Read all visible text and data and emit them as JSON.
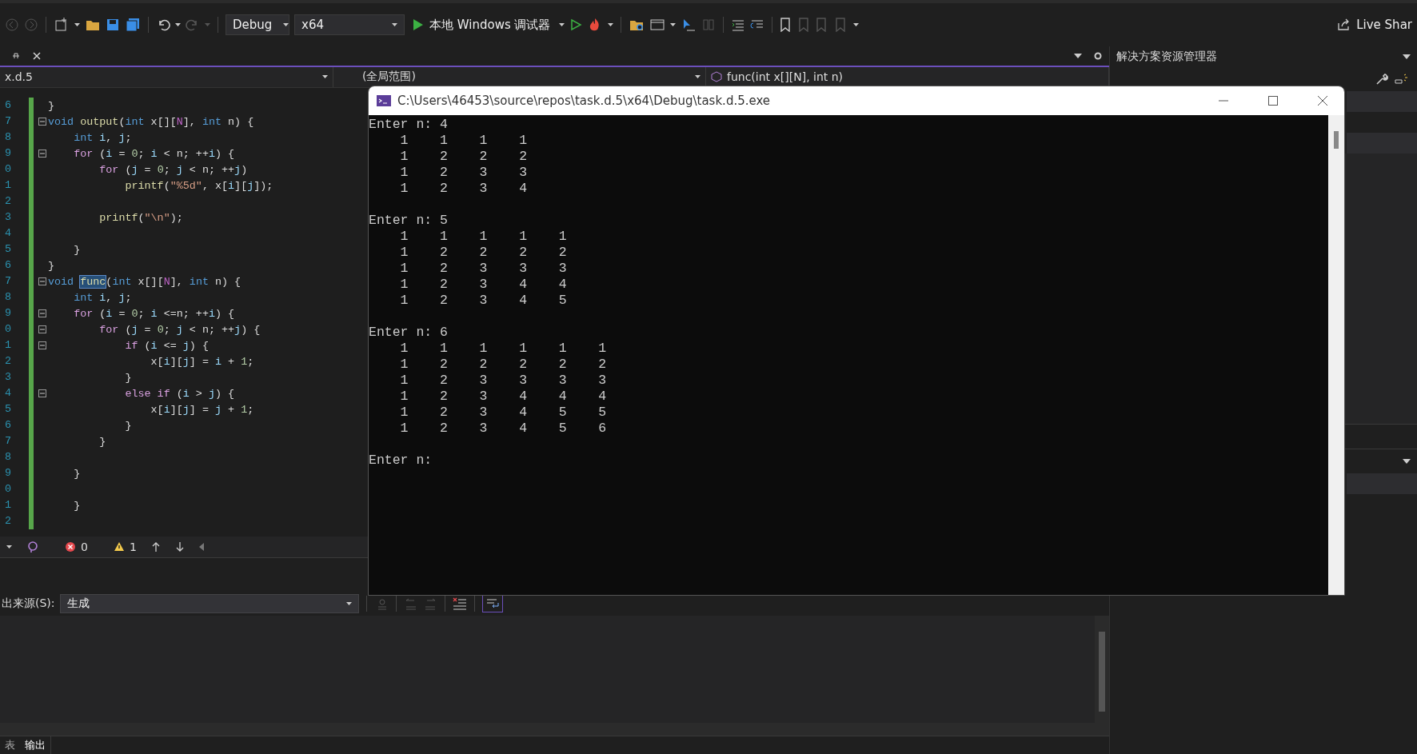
{
  "toolbar": {
    "configuration": "Debug",
    "platform": "x64",
    "run_label": "本地 Windows 调试器",
    "live_share": "Live Shar"
  },
  "navbar": {
    "project": "x.d.5",
    "scope": "(全局范围)",
    "member": "func(int x[][N], int n)"
  },
  "editor": {
    "lines": [
      {
        "number": "6",
        "fold": false,
        "tokens": [
          {
            "kind": "plain",
            "text": "}"
          }
        ]
      },
      {
        "number": "7",
        "fold": true,
        "tokens": [
          {
            "kind": "kw",
            "text": "void"
          },
          {
            "kind": "fn",
            "text": " output"
          },
          {
            "kind": "plain",
            "text": "("
          },
          {
            "kind": "kw",
            "text": "int"
          },
          {
            "kind": "plain",
            "text": " x[]["
          },
          {
            "kind": "macro",
            "text": "N"
          },
          {
            "kind": "plain",
            "text": "], "
          },
          {
            "kind": "kw",
            "text": "int"
          },
          {
            "kind": "plain",
            "text": " n) {"
          }
        ]
      },
      {
        "number": "8",
        "fold": false,
        "tokens": [
          {
            "kind": "kw",
            "text": "    int"
          },
          {
            "kind": "var",
            "text": " i"
          },
          {
            "kind": "plain",
            "text": ", "
          },
          {
            "kind": "var",
            "text": "j"
          },
          {
            "kind": "plain",
            "text": ";"
          }
        ]
      },
      {
        "number": "9",
        "fold": true,
        "tokens": [
          {
            "kind": "ctl",
            "text": "    for"
          },
          {
            "kind": "plain",
            "text": " ("
          },
          {
            "kind": "var",
            "text": "i"
          },
          {
            "kind": "plain",
            "text": " = "
          },
          {
            "kind": "num",
            "text": "0"
          },
          {
            "kind": "plain",
            "text": "; "
          },
          {
            "kind": "var",
            "text": "i"
          },
          {
            "kind": "plain",
            "text": " < n; ++"
          },
          {
            "kind": "var",
            "text": "i"
          },
          {
            "kind": "plain",
            "text": ") {"
          }
        ]
      },
      {
        "number": "0",
        "fold": false,
        "tokens": [
          {
            "kind": "ctl",
            "text": "        for"
          },
          {
            "kind": "plain",
            "text": " ("
          },
          {
            "kind": "var",
            "text": "j"
          },
          {
            "kind": "plain",
            "text": " = "
          },
          {
            "kind": "num",
            "text": "0"
          },
          {
            "kind": "plain",
            "text": "; "
          },
          {
            "kind": "var",
            "text": "j"
          },
          {
            "kind": "plain",
            "text": " < n; ++"
          },
          {
            "kind": "var",
            "text": "j"
          },
          {
            "kind": "plain",
            "text": ")"
          }
        ]
      },
      {
        "number": "1",
        "fold": false,
        "tokens": [
          {
            "kind": "fn",
            "text": "            printf"
          },
          {
            "kind": "plain",
            "text": "("
          },
          {
            "kind": "str",
            "text": "\"%5d\""
          },
          {
            "kind": "plain",
            "text": ", x["
          },
          {
            "kind": "var",
            "text": "i"
          },
          {
            "kind": "plain",
            "text": "]["
          },
          {
            "kind": "var",
            "text": "j"
          },
          {
            "kind": "plain",
            "text": "]);"
          }
        ]
      },
      {
        "number": "2",
        "fold": false
      },
      {
        "number": "3",
        "fold": false,
        "tokens": [
          {
            "kind": "fn",
            "text": "        printf"
          },
          {
            "kind": "plain",
            "text": "("
          },
          {
            "kind": "str",
            "text": "\"\\n\""
          },
          {
            "kind": "plain",
            "text": ");"
          }
        ]
      },
      {
        "number": "4",
        "fold": false
      },
      {
        "number": "5",
        "fold": false,
        "tokens": [
          {
            "kind": "plain",
            "text": "    }"
          }
        ]
      },
      {
        "number": "6",
        "fold": false,
        "tokens": [
          {
            "kind": "plain",
            "text": "}"
          }
        ]
      },
      {
        "number": "7",
        "fold": true,
        "tokens": [
          {
            "kind": "kw",
            "text": "void "
          },
          {
            "kind": "sel",
            "text": "func"
          },
          {
            "kind": "plain",
            "text": "("
          },
          {
            "kind": "kw",
            "text": "int"
          },
          {
            "kind": "plain",
            "text": " x[]["
          },
          {
            "kind": "macro",
            "text": "N"
          },
          {
            "kind": "plain",
            "text": "], "
          },
          {
            "kind": "kw",
            "text": "int"
          },
          {
            "kind": "plain",
            "text": " n) {"
          }
        ]
      },
      {
        "number": "8",
        "fold": false,
        "tokens": [
          {
            "kind": "kw",
            "text": "    int"
          },
          {
            "kind": "var",
            "text": " i"
          },
          {
            "kind": "plain",
            "text": ", "
          },
          {
            "kind": "var",
            "text": "j"
          },
          {
            "kind": "plain",
            "text": ";"
          }
        ]
      },
      {
        "number": "9",
        "fold": true,
        "tokens": [
          {
            "kind": "ctl",
            "text": "    for"
          },
          {
            "kind": "plain",
            "text": " ("
          },
          {
            "kind": "var",
            "text": "i"
          },
          {
            "kind": "plain",
            "text": " = "
          },
          {
            "kind": "num",
            "text": "0"
          },
          {
            "kind": "plain",
            "text": "; "
          },
          {
            "kind": "var",
            "text": "i"
          },
          {
            "kind": "plain",
            "text": " <=n; ++"
          },
          {
            "kind": "var",
            "text": "i"
          },
          {
            "kind": "plain",
            "text": ") {"
          }
        ]
      },
      {
        "number": "0",
        "fold": true,
        "tokens": [
          {
            "kind": "ctl",
            "text": "        for"
          },
          {
            "kind": "plain",
            "text": " ("
          },
          {
            "kind": "var",
            "text": "j"
          },
          {
            "kind": "plain",
            "text": " = "
          },
          {
            "kind": "num",
            "text": "0"
          },
          {
            "kind": "plain",
            "text": "; "
          },
          {
            "kind": "var",
            "text": "j"
          },
          {
            "kind": "plain",
            "text": " < n; ++"
          },
          {
            "kind": "var",
            "text": "j"
          },
          {
            "kind": "plain",
            "text": ") {"
          }
        ]
      },
      {
        "number": "1",
        "fold": true,
        "tokens": [
          {
            "kind": "ctl",
            "text": "            if"
          },
          {
            "kind": "plain",
            "text": " ("
          },
          {
            "kind": "var",
            "text": "i"
          },
          {
            "kind": "plain",
            "text": " <= "
          },
          {
            "kind": "var",
            "text": "j"
          },
          {
            "kind": "plain",
            "text": ") {"
          }
        ]
      },
      {
        "number": "2",
        "fold": false,
        "tokens": [
          {
            "kind": "plain",
            "text": "                x["
          },
          {
            "kind": "var",
            "text": "i"
          },
          {
            "kind": "plain",
            "text": "]["
          },
          {
            "kind": "var",
            "text": "j"
          },
          {
            "kind": "plain",
            "text": "] = "
          },
          {
            "kind": "var",
            "text": "i"
          },
          {
            "kind": "plain",
            "text": " + "
          },
          {
            "kind": "num",
            "text": "1"
          },
          {
            "kind": "plain",
            "text": ";"
          }
        ]
      },
      {
        "number": "3",
        "fold": false,
        "tokens": [
          {
            "kind": "plain",
            "text": "            }"
          }
        ]
      },
      {
        "number": "4",
        "fold": true,
        "tokens": [
          {
            "kind": "ctl",
            "text": "            else if"
          },
          {
            "kind": "plain",
            "text": " ("
          },
          {
            "kind": "var",
            "text": "i"
          },
          {
            "kind": "plain",
            "text": " > "
          },
          {
            "kind": "var",
            "text": "j"
          },
          {
            "kind": "plain",
            "text": ") {"
          }
        ]
      },
      {
        "number": "5",
        "fold": false,
        "tokens": [
          {
            "kind": "plain",
            "text": "                x["
          },
          {
            "kind": "var",
            "text": "i"
          },
          {
            "kind": "plain",
            "text": "]["
          },
          {
            "kind": "var",
            "text": "j"
          },
          {
            "kind": "plain",
            "text": "] = "
          },
          {
            "kind": "var",
            "text": "j"
          },
          {
            "kind": "plain",
            "text": " + "
          },
          {
            "kind": "num",
            "text": "1"
          },
          {
            "kind": "plain",
            "text": ";"
          }
        ]
      },
      {
        "number": "6",
        "fold": false,
        "tokens": [
          {
            "kind": "plain",
            "text": "            }"
          }
        ]
      },
      {
        "number": "7",
        "fold": false,
        "tokens": [
          {
            "kind": "plain",
            "text": "        }"
          }
        ]
      },
      {
        "number": "8",
        "fold": false
      },
      {
        "number": "9",
        "fold": false,
        "tokens": [
          {
            "kind": "plain",
            "text": "    }"
          }
        ]
      },
      {
        "number": "0",
        "fold": false
      },
      {
        "number": "1",
        "fold": false,
        "tokens": [
          {
            "kind": "plain",
            "text": "    }"
          }
        ]
      },
      {
        "number": "2",
        "fold": false
      }
    ],
    "status": {
      "errors": "0",
      "warnings": "1"
    }
  },
  "output": {
    "source_label": "出来源(S):",
    "source": "生成",
    "tabs": [
      {
        "label": "表",
        "selected": false
      },
      {
        "label": "输出",
        "selected": true
      }
    ]
  },
  "solution_explorer": {
    "title": "解决方案资源管理器"
  },
  "console": {
    "title": "C:\\Users\\46453\\source\\repos\\task.d.5\\x64\\Debug\\task.d.5.exe",
    "blocks": [
      {
        "prompt": "Enter n: 4",
        "rows": [
          "    1    1    1    1",
          "    1    2    2    2",
          "    1    2    3    3",
          "    1    2    3    4"
        ]
      },
      {
        "prompt": "Enter n: 5",
        "rows": [
          "    1    1    1    1    1",
          "    1    2    2    2    2",
          "    1    2    3    3    3",
          "    1    2    3    4    4",
          "    1    2    3    4    5"
        ]
      },
      {
        "prompt": "Enter n: 6",
        "rows": [
          "    1    1    1    1    1    1",
          "    1    2    2    2    2    2",
          "    1    2    3    3    3    3",
          "    1    2    3    4    4    4",
          "    1    2    3    4    5    5",
          "    1    2    3    4    5    6"
        ]
      },
      {
        "prompt": "Enter n:"
      }
    ]
  }
}
